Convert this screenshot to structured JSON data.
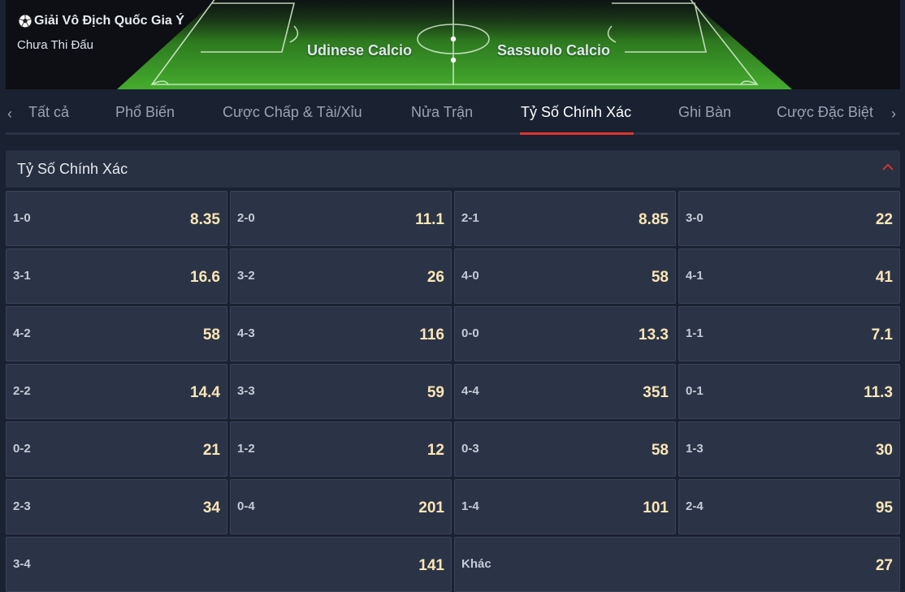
{
  "header": {
    "league": "Giải Vô Địch Quốc Gia Ý",
    "status": "Chưa Thi Đấu",
    "home_team": "Udinese Calcio",
    "away_team": "Sassuolo Calcio"
  },
  "tabs": [
    {
      "label": "Tất cả"
    },
    {
      "label": "Phổ Biến"
    },
    {
      "label": "Cược Chấp & Tài/Xỉu"
    },
    {
      "label": "Nửa Trận"
    },
    {
      "label": "Tỷ Số Chính Xác"
    },
    {
      "label": "Ghi Bàn"
    },
    {
      "label": "Cược Đặc Biệt"
    }
  ],
  "active_tab": "Tỷ Số Chính Xác",
  "market": {
    "title": "Tỷ Số Chính Xác",
    "rows": [
      [
        {
          "score": "1-0",
          "odds": "8.35"
        },
        {
          "score": "2-0",
          "odds": "11.1"
        },
        {
          "score": "2-1",
          "odds": "8.85"
        },
        {
          "score": "3-0",
          "odds": "22"
        }
      ],
      [
        {
          "score": "3-1",
          "odds": "16.6"
        },
        {
          "score": "3-2",
          "odds": "26"
        },
        {
          "score": "4-0",
          "odds": "58"
        },
        {
          "score": "4-1",
          "odds": "41"
        }
      ],
      [
        {
          "score": "4-2",
          "odds": "58"
        },
        {
          "score": "4-3",
          "odds": "116"
        },
        {
          "score": "0-0",
          "odds": "13.3"
        },
        {
          "score": "1-1",
          "odds": "7.1"
        }
      ],
      [
        {
          "score": "2-2",
          "odds": "14.4"
        },
        {
          "score": "3-3",
          "odds": "59"
        },
        {
          "score": "4-4",
          "odds": "351"
        },
        {
          "score": "0-1",
          "odds": "11.3"
        }
      ],
      [
        {
          "score": "0-2",
          "odds": "21"
        },
        {
          "score": "1-2",
          "odds": "12"
        },
        {
          "score": "0-3",
          "odds": "58"
        },
        {
          "score": "1-3",
          "odds": "30"
        }
      ],
      [
        {
          "score": "2-3",
          "odds": "34"
        },
        {
          "score": "0-4",
          "odds": "201"
        },
        {
          "score": "1-4",
          "odds": "101"
        },
        {
          "score": "2-4",
          "odds": "95"
        }
      ],
      [
        {
          "score": "3-4",
          "odds": "141"
        },
        {
          "score": "Khác",
          "odds": "27"
        }
      ]
    ]
  },
  "colors": {
    "accent": "#e0362d",
    "odds": "#fbe6b4",
    "pitch": "#3fa02a"
  }
}
